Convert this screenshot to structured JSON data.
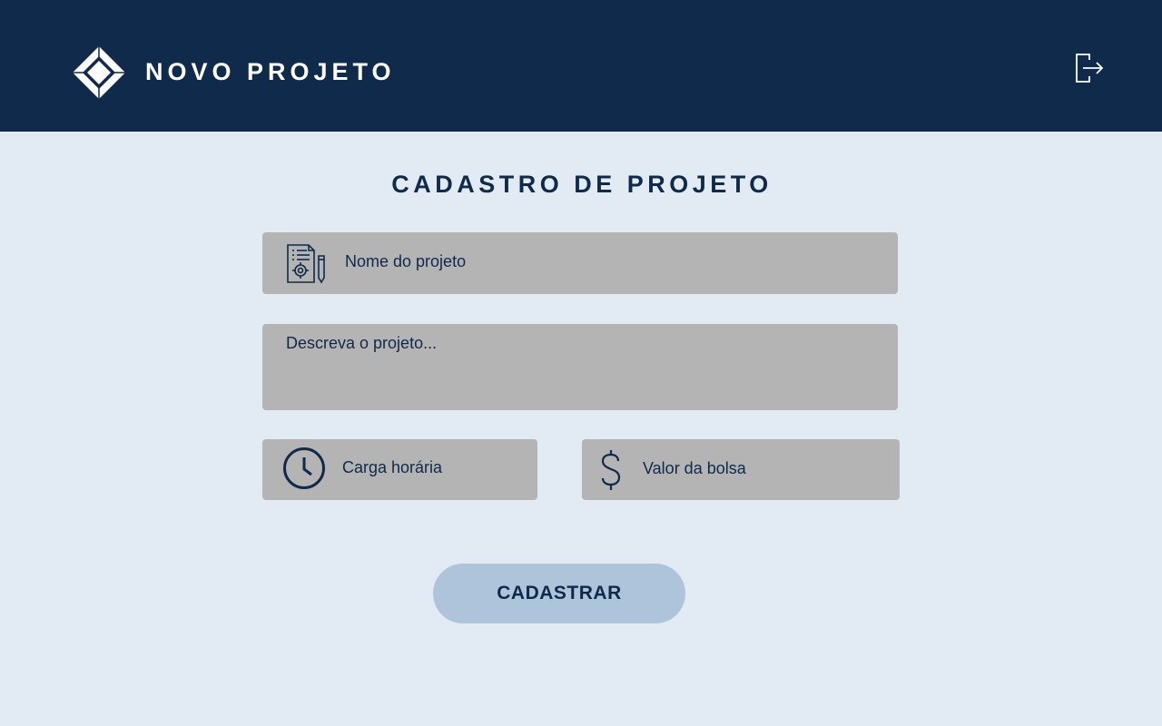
{
  "header": {
    "title": "NOVO PROJETO",
    "logo_icon": "diamond-logo-icon",
    "logout_icon": "logout-icon"
  },
  "form": {
    "title": "CADASTRO DE PROJETO",
    "project_name": {
      "placeholder": "Nome do projeto",
      "value": "",
      "icon": "document-settings-icon"
    },
    "description": {
      "placeholder": "Descreva o projeto...",
      "value": ""
    },
    "workload": {
      "placeholder": "Carga horária",
      "value": "",
      "icon": "clock-icon"
    },
    "scholarship_value": {
      "placeholder": "Valor da bolsa",
      "value": "",
      "icon": "dollar-icon"
    },
    "submit_label": "CADASTRAR"
  },
  "colors": {
    "header_bg": "#0f2a4a",
    "page_bg": "#e2ebf4",
    "field_bg": "#b4b4b4",
    "button_bg": "#adc4db",
    "text_dark": "#0f2a4a"
  }
}
